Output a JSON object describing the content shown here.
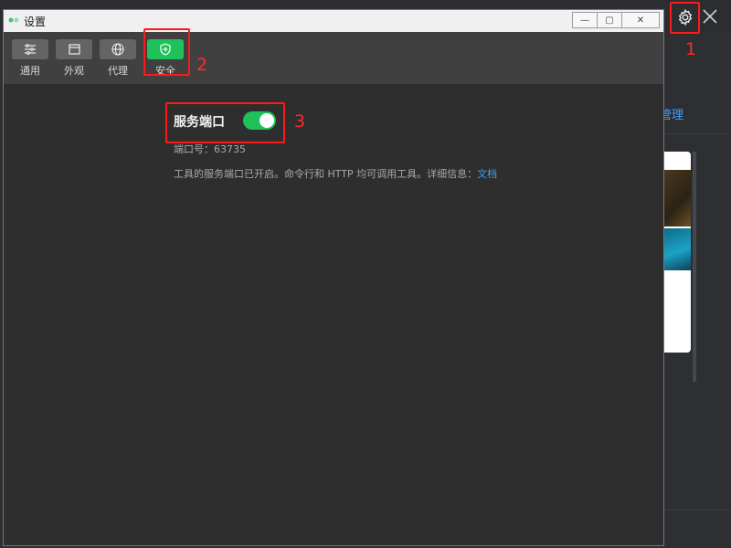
{
  "window": {
    "title": "设置",
    "minimize_symbol": "—",
    "restore_symbol": "▢",
    "close_symbol": "✕"
  },
  "tabs": [
    {
      "label": "通用",
      "icon": "sliders-icon",
      "active": false
    },
    {
      "label": "外观",
      "icon": "window-icon",
      "active": false
    },
    {
      "label": "代理",
      "icon": "globe-icon",
      "active": false
    },
    {
      "label": "安全",
      "icon": "shield-icon",
      "active": true
    }
  ],
  "security": {
    "service_port_label": "服务端口",
    "service_port_enabled": true,
    "port_text": "端口号：63735",
    "description": "工具的服务端口已开启。命令行和 HTTP 均可调用工具。详细信息：",
    "doc_link": "文档"
  },
  "background": {
    "manage_link": "管理"
  },
  "annotations": [
    "1",
    "2",
    "3"
  ],
  "colors": {
    "accent_green": "#1fc25a",
    "link_blue": "#3ba1ff",
    "annotation_red": "#ff1a1a"
  }
}
